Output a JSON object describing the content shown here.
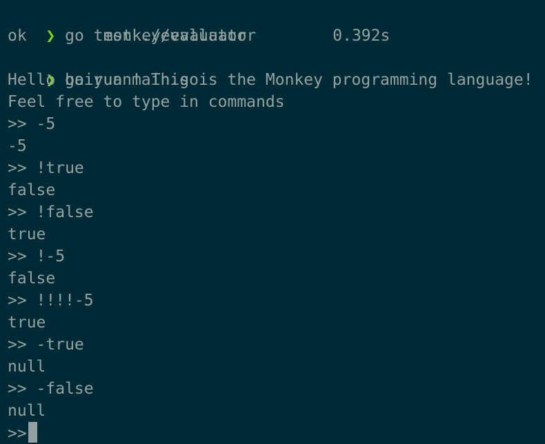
{
  "shell": {
    "prompt_symbol": "❯"
  },
  "lines": {
    "cmd_test": "go test ./evaluator",
    "test_status": "ok",
    "test_package": "monkey/evaluator",
    "test_time": "0.392s",
    "cmd_run": "go run main.go",
    "greeting": "Hello baiyuan! This is the Monkey programming language!",
    "instructions": "Feel free to type in commands",
    "in1": ">> -5",
    "out1": "-5",
    "in2": ">> !true",
    "out2": "false",
    "in3": ">> !false",
    "out3": "true",
    "in4": ">> !-5",
    "out4": "false",
    "in5": ">> !!!!-5",
    "out5": "true",
    "in6": ">> -true",
    "out6": "null",
    "in7": ">> -false",
    "out7": "null",
    "repl_prompt": ">>"
  },
  "colors": {
    "background": "#002b36",
    "text": "#93a1a1",
    "prompt_arrow": "#7fd320",
    "cursor": "#93a1a1"
  }
}
